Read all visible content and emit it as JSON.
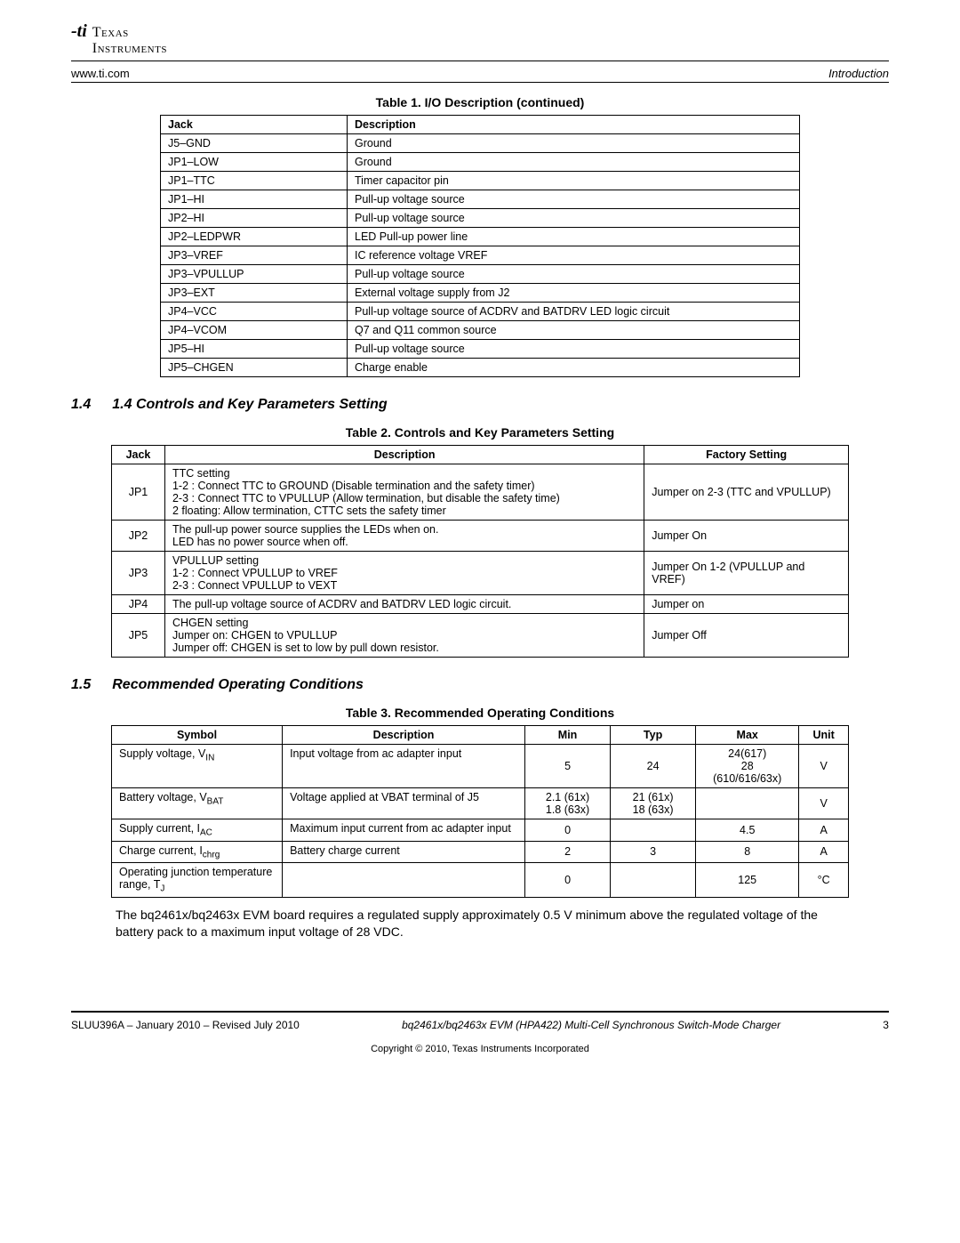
{
  "header": {
    "brand_line1": "Texas",
    "brand_line2": "Instruments",
    "url": "www.ti.com",
    "section_label": "Introduction"
  },
  "table1": {
    "caption": "Table 1. I/O Description  (continued)",
    "headers": [
      "Jack",
      "Description"
    ],
    "rows": [
      [
        "J5–GND",
        "Ground"
      ],
      [
        "JP1–LOW",
        "Ground"
      ],
      [
        "JP1–TTC",
        "Timer capacitor pin"
      ],
      [
        "JP1–HI",
        "Pull-up voltage source"
      ],
      [
        "JP2–HI",
        "Pull-up voltage source"
      ],
      [
        "JP2–LEDPWR",
        "LED Pull-up power line"
      ],
      [
        "JP3–VREF",
        "IC reference voltage VREF"
      ],
      [
        "JP3–VPULLUP",
        "Pull-up voltage source"
      ],
      [
        "JP3–EXT",
        "External voltage supply from J2"
      ],
      [
        "JP4–VCC",
        "Pull-up voltage source of ACDRV and BATDRV LED logic circuit"
      ],
      [
        "JP4–VCOM",
        "Q7 and Q11 common source"
      ],
      [
        "JP5–HI",
        "Pull-up voltage source"
      ],
      [
        "JP5–CHGEN",
        "Charge enable"
      ]
    ]
  },
  "section14": {
    "num": "1.4",
    "title": "1.4 Controls and Key Parameters Setting"
  },
  "table2": {
    "caption": "Table 2. Controls and Key Parameters Setting",
    "headers": [
      "Jack",
      "Description",
      "Factory Setting"
    ],
    "rows": [
      [
        "JP1",
        "TTC setting\n1-2 : Connect TTC to GROUND (Disable termination and the safety timer)\n2-3 : Connect TTC to VPULLUP (Allow termination, but disable the safety time)\n2 floating: Allow termination, CTTC sets the safety timer",
        "Jumper on 2-3 (TTC and VPULLUP)"
      ],
      [
        "JP2",
        "The pull-up power source supplies the LEDs when on.\nLED has no power source when off.",
        "Jumper On"
      ],
      [
        "JP3",
        "VPULLUP setting\n1-2 : Connect VPULLUP to VREF\n2-3 : Connect VPULLUP to VEXT",
        "Jumper On 1-2 (VPULLUP and VREF)"
      ],
      [
        "JP4",
        "The pull-up voltage source of ACDRV and BATDRV LED logic circuit.",
        "Jumper on"
      ],
      [
        "JP5",
        "CHGEN setting\nJumper on: CHGEN to VPULLUP\nJumper off: CHGEN is set to low by pull down resistor.",
        "Jumper Off"
      ]
    ]
  },
  "section15": {
    "num": "1.5",
    "title": "Recommended Operating Conditions"
  },
  "table3": {
    "caption": "Table 3. Recommended Operating Conditions",
    "headers": [
      "Symbol",
      "Description",
      "Min",
      "Typ",
      "Max",
      "Unit"
    ],
    "rows": [
      {
        "symbol_html": "Supply voltage, V<sub>IN</sub>",
        "desc": "Input voltage from ac adapter input",
        "min": "5",
        "typ": "24",
        "max": "24(617)\n28\n(610/616/63x)",
        "unit": "V"
      },
      {
        "symbol_html": "Battery voltage, V<sub>BAT</sub>",
        "desc": "Voltage applied at VBAT terminal of J5",
        "min": "2.1 (61x)\n1.8 (63x)",
        "typ": "21 (61x)\n18 (63x)",
        "max": "",
        "unit": "V"
      },
      {
        "symbol_html": "Supply current, I<sub>AC</sub>",
        "desc": "Maximum input current from ac adapter input",
        "min": "0",
        "typ": "",
        "max": "4.5",
        "unit": "A"
      },
      {
        "symbol_html": "Charge current, I<sub>chrg</sub>",
        "desc": "Battery charge current",
        "min": "2",
        "typ": "3",
        "max": "8",
        "unit": "A"
      },
      {
        "symbol_html": "Operating junction temperature range, T<sub>J</sub>",
        "desc": "",
        "min": "0",
        "typ": "",
        "max": "125",
        "unit": "°C"
      }
    ]
  },
  "body_paragraph": "The bq2461x/bq2463x EVM board requires a regulated supply approximately 0.5 V minimum above the regulated voltage of the battery pack to a maximum input voltage of 28 VDC.",
  "footer": {
    "left": "SLUU396A – January 2010 – Revised July 2010",
    "mid": "bq2461x/bq2463x EVM (HPA422) Multi-Cell Synchronous Switch-Mode Charger",
    "page": "3",
    "copyright": "Copyright © 2010, Texas Instruments Incorporated"
  }
}
